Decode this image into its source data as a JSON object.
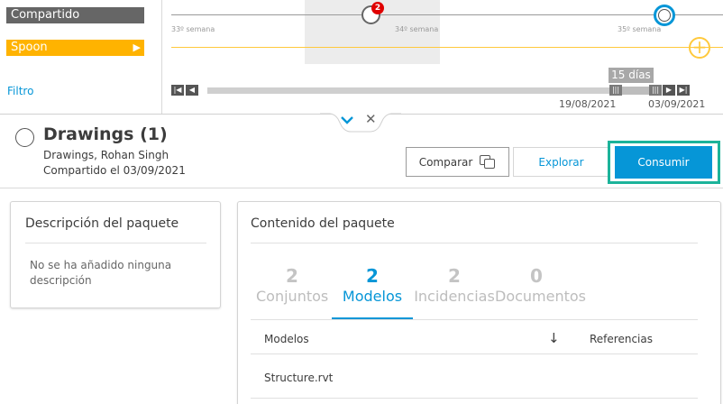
{
  "timeline": {
    "shared_label": "Compartido",
    "spoon_label": "Spoon",
    "spoon_arrow": "▶",
    "filter_label": "Filtro",
    "week_labels": [
      "33º semana",
      "34º semana",
      "35º semana"
    ],
    "node_badge": "2",
    "add_symbol": "+",
    "range_label": "15 días",
    "date_start": "19/08/2021",
    "date_end": "03/09/2021",
    "colors": {
      "shared": "#666666",
      "spoon": "#ffb300",
      "accent": "#0696d7",
      "alert": "#e00000"
    }
  },
  "collapse": {
    "chevron": "⌄",
    "close": "✕"
  },
  "package": {
    "title": "Drawings (1)",
    "authors": "Drawings, Rohan Singh",
    "shared_on": "Compartido el 03/09/2021"
  },
  "actions": {
    "compare": "Comparar",
    "explore": "Explorar",
    "consume": "Consumir",
    "highlight_color": "#1cb39a"
  },
  "description_panel": {
    "title": "Descripción del paquete",
    "text": "No se ha añadido ninguna descripción"
  },
  "content_panel": {
    "title": "Contenido del paquete",
    "tabs": [
      {
        "count": "2",
        "label": "Conjuntos",
        "active": false
      },
      {
        "count": "2",
        "label": "Modelos",
        "active": true
      },
      {
        "count": "2",
        "label": "Incidencias",
        "active": false
      },
      {
        "count": "0",
        "label": "Documentos",
        "active": false
      }
    ],
    "columns": {
      "models": "Modelos",
      "references": "Referencias",
      "sort_icon": "↓"
    },
    "rows": [
      {
        "model": "Structure.rvt",
        "references": ""
      }
    ]
  }
}
